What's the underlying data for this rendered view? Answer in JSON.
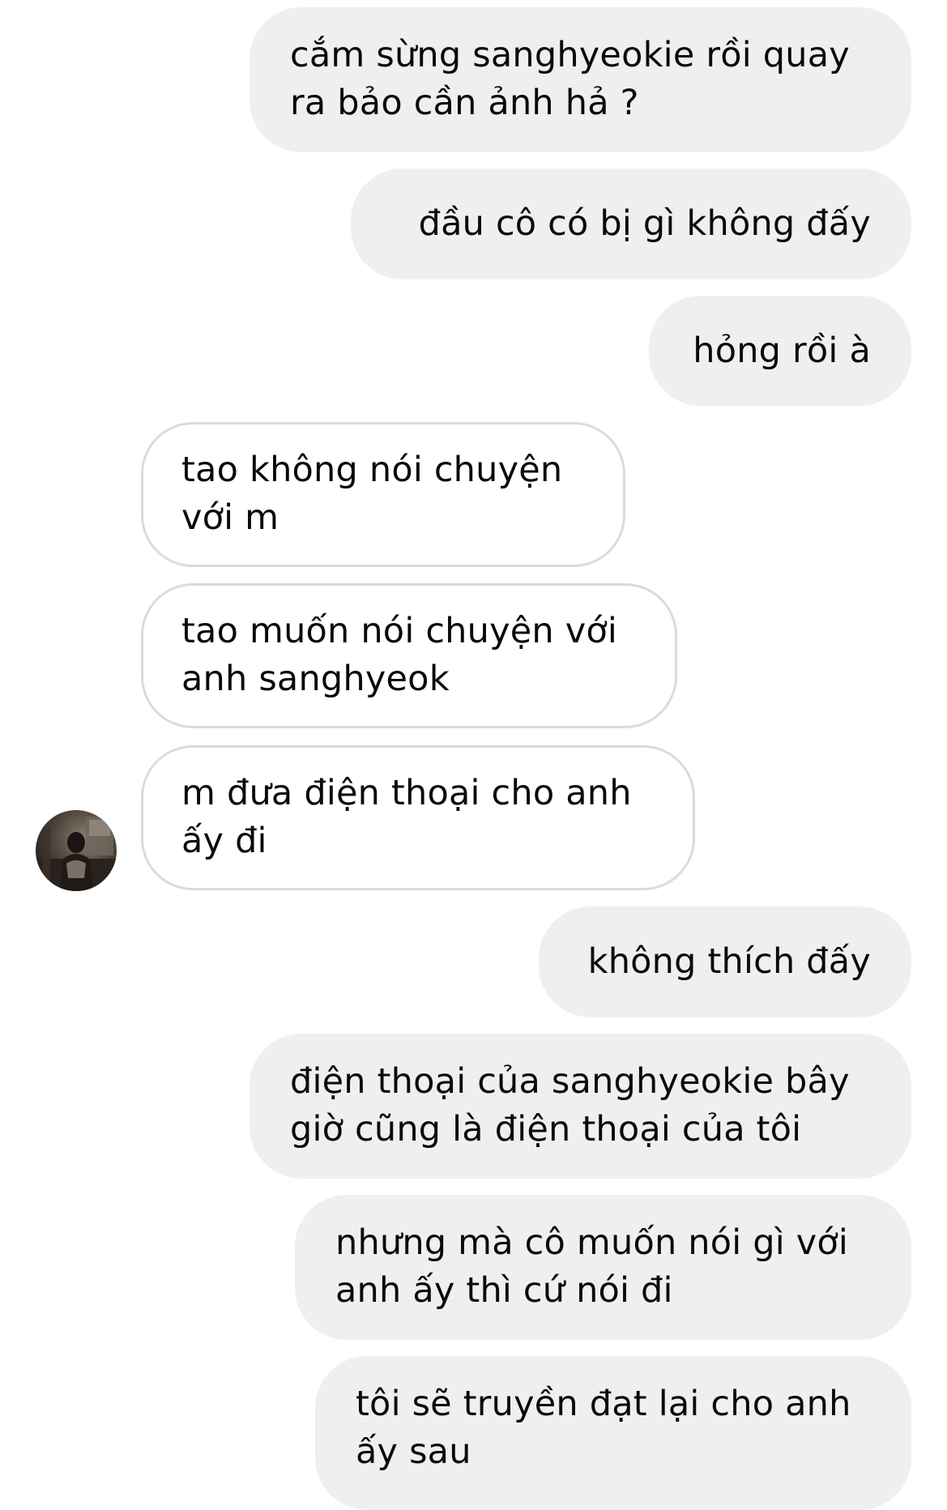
{
  "conversation": {
    "messages": [
      {
        "id": "m1",
        "direction": "outgoing",
        "text": "cắm sừng sanghyeokie rồi quay\nra bảo cần ảnh hả ?"
      },
      {
        "id": "m2",
        "direction": "outgoing",
        "text": "đầu cô có bị gì không đấy"
      },
      {
        "id": "m3",
        "direction": "outgoing",
        "text": "hỏng rồi à"
      },
      {
        "id": "m4",
        "direction": "incoming",
        "text": "tao không nói chuyện\nvới m"
      },
      {
        "id": "m5",
        "direction": "incoming",
        "text": "tao muốn nói chuyện với\nanh sanghyeok"
      },
      {
        "id": "m6",
        "direction": "incoming",
        "text": "m đưa điện thoại cho anh\nấy đi"
      },
      {
        "id": "m7",
        "direction": "outgoing",
        "text": "không thích đấy"
      },
      {
        "id": "m8",
        "direction": "outgoing",
        "text": "điện thoại của sanghyeokie bây\ngiờ cũng là điện thoại của tôi"
      },
      {
        "id": "m9",
        "direction": "outgoing",
        "text": "nhưng mà cô muốn nói gì với\nanh ấy thì cứ nói đi"
      },
      {
        "id": "m10",
        "direction": "outgoing",
        "text": "tôi sẽ truyền đạt lại cho anh\nấy sau"
      }
    ]
  },
  "colors": {
    "outgoing_bubble": "#efefef",
    "incoming_border": "#dbdbdb",
    "text": "#0a0a0a",
    "background": "#ffffff"
  },
  "icons": {
    "contact_avatar": "contact-avatar-photo"
  }
}
